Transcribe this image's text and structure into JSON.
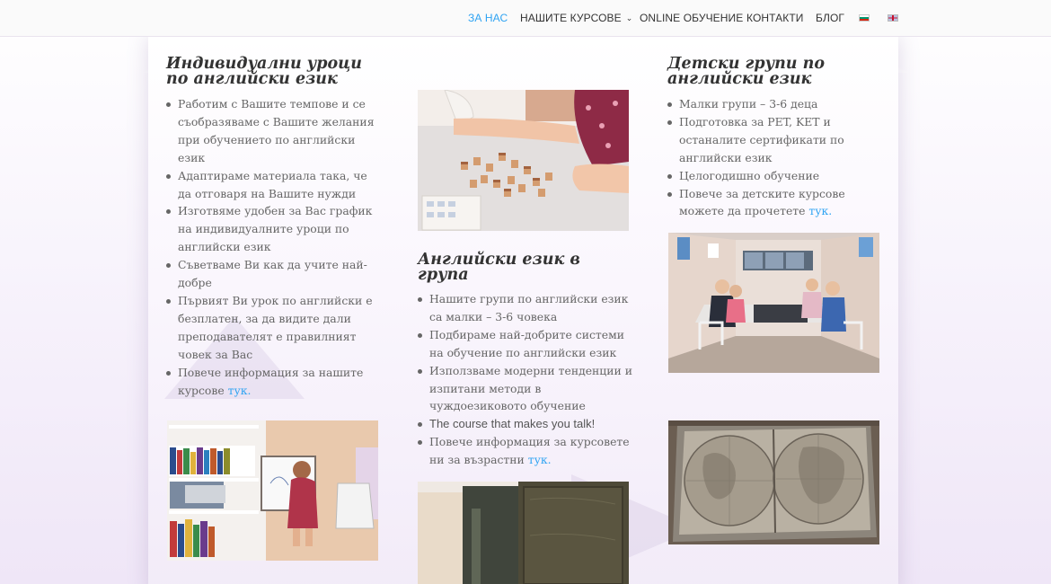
{
  "nav": {
    "items": [
      {
        "label": "ЗА НАС",
        "active": true
      },
      {
        "label": "НАШИТЕ КУРСОВЕ",
        "dropdown": true
      },
      {
        "label": "ONLINE ОБУЧЕНИЕ"
      },
      {
        "label": "КОНТАКТИ"
      },
      {
        "label": "БЛОГ"
      }
    ],
    "flags": [
      "bg-flag-icon",
      "en-flag-icon"
    ]
  },
  "colors": {
    "accent": "#2ea3f2",
    "text": "#666666",
    "heading": "#333333"
  },
  "col1": {
    "heading_1": "Индивидуални уроци",
    "heading_2": "по английски език",
    "items": [
      "Работим с Вашите темпове и се съобразяваме с Вашите желания при обучението по английски език",
      "Адаптираме материала така, че да отговаря на Вашите нужди",
      "Изготвяме удобен за Вас график на индивидуалните уроци по английски език",
      "Съветваме Ви как да учите най-добре",
      "Първият Ви урок по английски е безплатен, за да видите дали преподавателят е правилният човек за Вас"
    ],
    "last_item_text": "Повече информация за нашите курсове ",
    "last_item_link": "тук."
  },
  "col2": {
    "heading": "Английски език в група",
    "items": [
      "Нашите групи по английски език са малки – 3-6 човека",
      "Подбираме най-добрите системи на обучение по английски език",
      "Използваме модерни тенденции и изпитани методи в чуждоезиковото обучение"
    ],
    "slogan": "The course that makes you talk!",
    "last_item_text": "Повече информация за курсовете ни за възрастни ",
    "last_item_link": "тук."
  },
  "col3": {
    "heading_1": "Детски групи по",
    "heading_2": "английски език",
    "items": [
      "Малки групи – 3-6 деца",
      "Подготовка за PET, KET и останалите сертификати по английски език",
      "Целогодишно обучение"
    ],
    "last_item_text": "Повече за детските курсове можете да прочетете ",
    "last_item_link": "тук."
  }
}
